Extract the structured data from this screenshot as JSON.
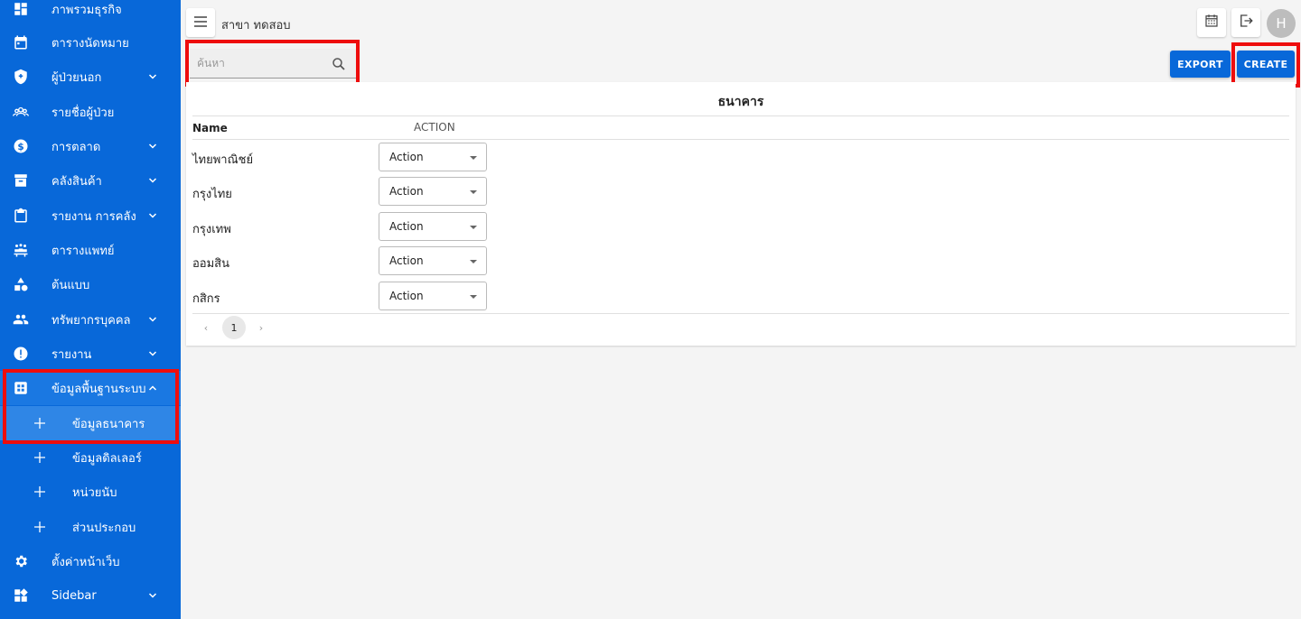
{
  "sidebar": {
    "items": [
      {
        "label": "ภาพรวมธุรกิจ",
        "icon": "dashboard-icon",
        "expand": false
      },
      {
        "label": "ตารางนัดหมาย",
        "icon": "calendar-icon",
        "expand": false
      },
      {
        "label": "ผู้ป่วยนอก",
        "icon": "shield-icon",
        "expand": true
      },
      {
        "label": "รายชื่อผู้ป่วย",
        "icon": "patients-icon",
        "expand": false
      },
      {
        "label": "การตลาด",
        "icon": "dollar-icon",
        "expand": true
      },
      {
        "label": "คลังสินค้า",
        "icon": "archive-icon",
        "expand": true
      },
      {
        "label": "รายงาน การคลัง",
        "icon": "clipboard-icon",
        "expand": true
      },
      {
        "label": "ตารางแพทย์",
        "icon": "doctors-icon",
        "expand": false
      },
      {
        "label": "ต้นแบบ",
        "icon": "shapes-icon",
        "expand": false
      },
      {
        "label": "ทรัพยากรบุคคล",
        "icon": "people-icon",
        "expand": true
      },
      {
        "label": "รายงาน",
        "icon": "alert-icon",
        "expand": true
      },
      {
        "label": "ข้อมูลพื้นฐานระบบ",
        "icon": "grid-icon",
        "expand": true
      }
    ],
    "subitems": [
      "ข้อมูลธนาคาร",
      "ข้อมูลดิลเลอร์",
      "หน่วยนับ",
      "ส่วนประกอบ"
    ],
    "bottom": [
      {
        "label": "ตั้งค่าหน้าเว็บ",
        "icon": "gear-icon",
        "expand": false
      },
      {
        "label": "Sidebar",
        "icon": "widgets-icon",
        "expand": true
      }
    ]
  },
  "header": {
    "branch": "สาขา ทดสอบ",
    "avatar": "H"
  },
  "search": {
    "placeholder": "ค้นหา"
  },
  "buttons": {
    "export": "EXPORT",
    "create": "CREATE"
  },
  "table": {
    "title": "ธนาคาร",
    "col_name": "Name",
    "col_action": "ACTION",
    "rows": [
      {
        "name": "ไทยพาณิชย์",
        "action": "Action"
      },
      {
        "name": "กรุงไทย",
        "action": "Action"
      },
      {
        "name": "กรุงเทพ",
        "action": "Action"
      },
      {
        "name": "ออมสิน",
        "action": "Action"
      },
      {
        "name": "กสิกร",
        "action": "Action"
      }
    ]
  },
  "pagination": {
    "current": "1",
    "prev": "‹",
    "next": "›"
  },
  "colors": {
    "sidebar": "#0868d9",
    "primary": "#0868d9",
    "highlight": "#ee0d0d"
  }
}
